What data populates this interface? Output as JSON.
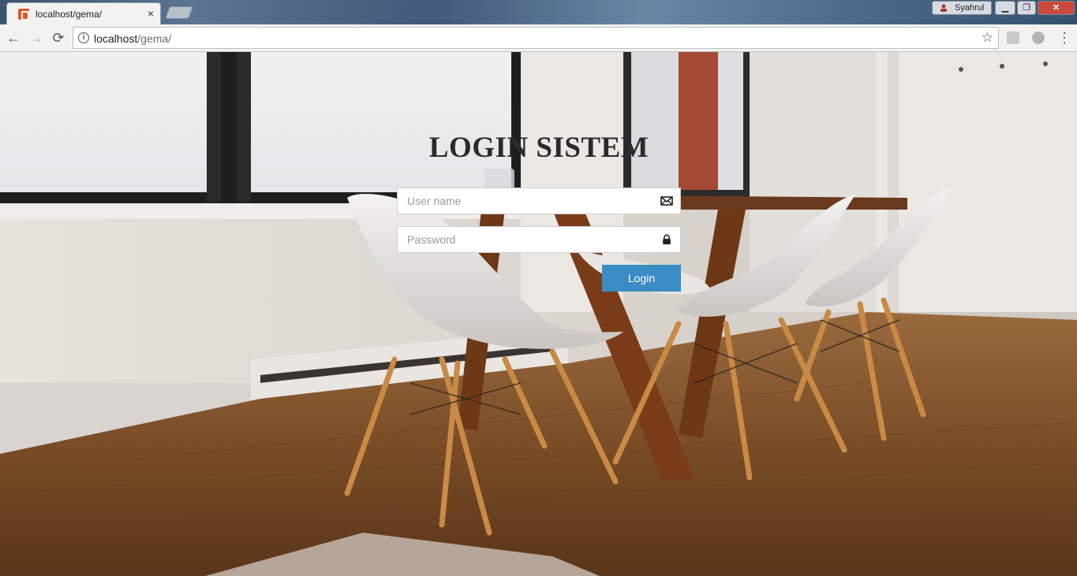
{
  "browser": {
    "tab": {
      "title": "localhost/gema/",
      "close_label": "×",
      "favicon": "xampp-favicon-icon"
    },
    "profile": {
      "name": "Syahrul"
    },
    "window_controls": {
      "minimize": "▭",
      "maximize": "❐",
      "close": "✕"
    },
    "toolbar": {
      "back_label": "←",
      "forward_label": "→",
      "reload_label": "⟳",
      "url_host": "localhost",
      "url_path": "/gema/",
      "bookmark_label": "☆",
      "menu_label": "⋮"
    }
  },
  "login": {
    "title": "LOGIN SISTEM",
    "username_placeholder": "User name",
    "username_value": "",
    "password_placeholder": "Password",
    "password_value": "",
    "submit_label": "Login",
    "button_color": "#3a8cc4"
  }
}
